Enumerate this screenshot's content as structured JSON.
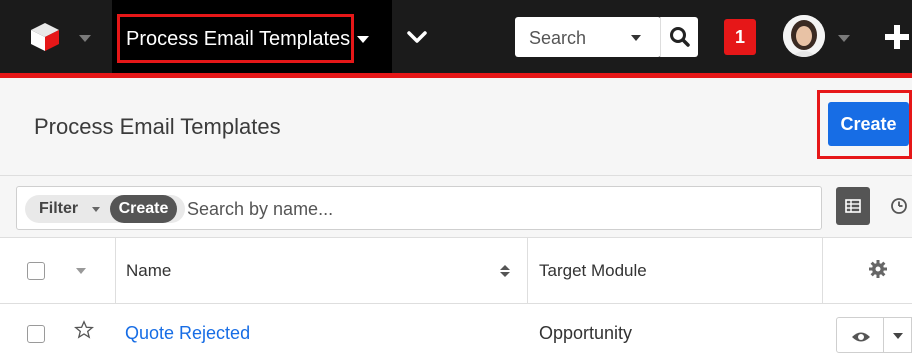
{
  "nav": {
    "module_tab": "Process Email Templates",
    "search_label": "Search",
    "notification_count": "1",
    "icons": [
      "logo-cube-icon",
      "chevron-down-icon",
      "search-icon",
      "plus-icon"
    ]
  },
  "header": {
    "title": "Process Email Templates",
    "create_label": "Create"
  },
  "filter": {
    "filter_label": "Filter",
    "create_label": "Create",
    "placeholder": "Search by name..."
  },
  "table": {
    "columns": [
      "Name",
      "Target Module"
    ],
    "rows": [
      {
        "name": "Quote Rejected",
        "target_module": "Opportunity"
      }
    ]
  },
  "colors": {
    "nav_bg": "#1b1b1b",
    "accent_red": "#e61718",
    "primary_blue": "#176de5"
  }
}
